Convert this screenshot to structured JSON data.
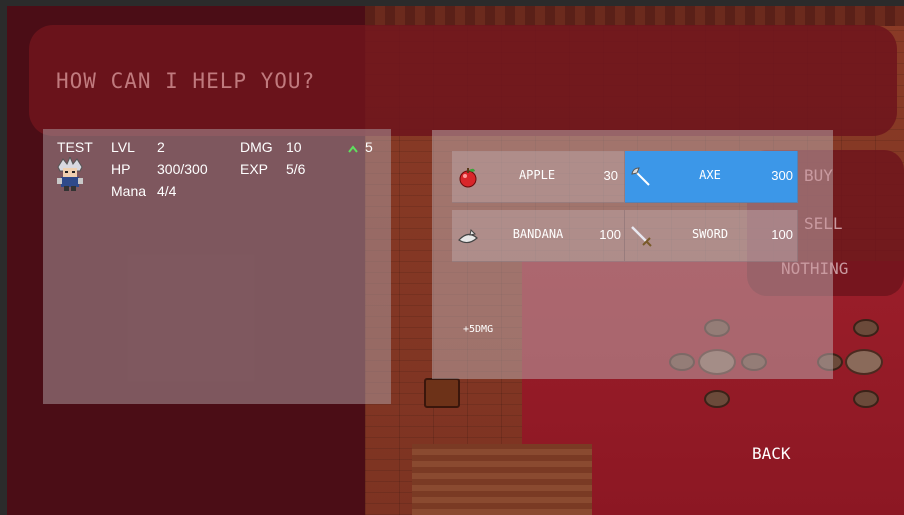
{
  "dialog": {
    "text": "HOW CAN I HELP YOU?"
  },
  "hero": {
    "name": "TEST",
    "lvl_label": "LVL",
    "lvl": "2",
    "dmg_label": "DMG",
    "dmg": "10",
    "dmg_bonus": "5",
    "hp_label": "HP",
    "hp": "300/300",
    "exp_label": "EXP",
    "exp": "5/6",
    "mana_label": "Mana",
    "mana": "4/4",
    "sprite_icon": "hero-sprite-icon",
    "bonus_icon": "up-arrow-icon",
    "bonus_color": "#5ee05e"
  },
  "shop": {
    "items": [
      {
        "name": "APPLE",
        "price": "30",
        "icon": "apple-icon"
      },
      {
        "name": "AXE",
        "price": "300",
        "icon": "axe-icon",
        "selected": true
      },
      {
        "name": "BANDANA",
        "price": "100",
        "icon": "bandana-icon"
      },
      {
        "name": "SWORD",
        "price": "100",
        "icon": "sword-icon"
      }
    ],
    "selected_description": "+5DMG",
    "selected_color": "#3c97e8"
  },
  "choices": {
    "buy": "BUY",
    "sell": "SELL",
    "nothing": "NOTHING"
  },
  "back_label": "BACK"
}
